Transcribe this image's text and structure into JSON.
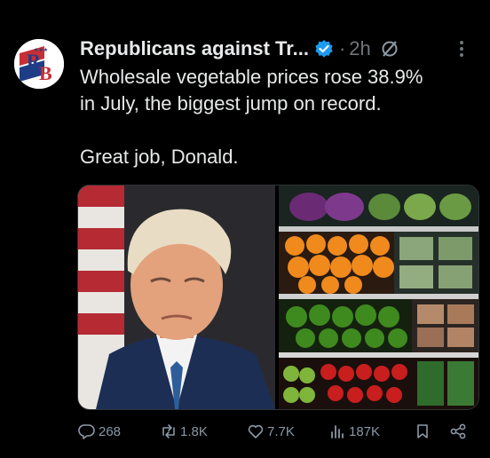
{
  "tweet": {
    "author_name": "Republicans against Tr...",
    "timestamp": "2h",
    "separator": "·",
    "avatar_initials": "RB",
    "text_line1": "Wholesale vegetable prices rose 38.9%",
    "text_line2": "in July, the biggest jump on record.",
    "text_line3": "Great job, Donald.",
    "media": {
      "left_image": "portrait-photo",
      "right_image": "vegetable-shelves-photo"
    }
  },
  "actions": {
    "replies": "268",
    "reposts": "1.8K",
    "likes": "7.7K",
    "views": "187K"
  },
  "colors": {
    "background": "#000000",
    "text": "#e7e9ea",
    "muted": "#71767b",
    "verified": "#1d9bf0"
  },
  "icons": [
    "verified-badge-icon",
    "grok-icon",
    "more-icon",
    "reply-icon",
    "repost-icon",
    "like-icon",
    "views-icon",
    "bookmark-icon",
    "share-icon"
  ]
}
